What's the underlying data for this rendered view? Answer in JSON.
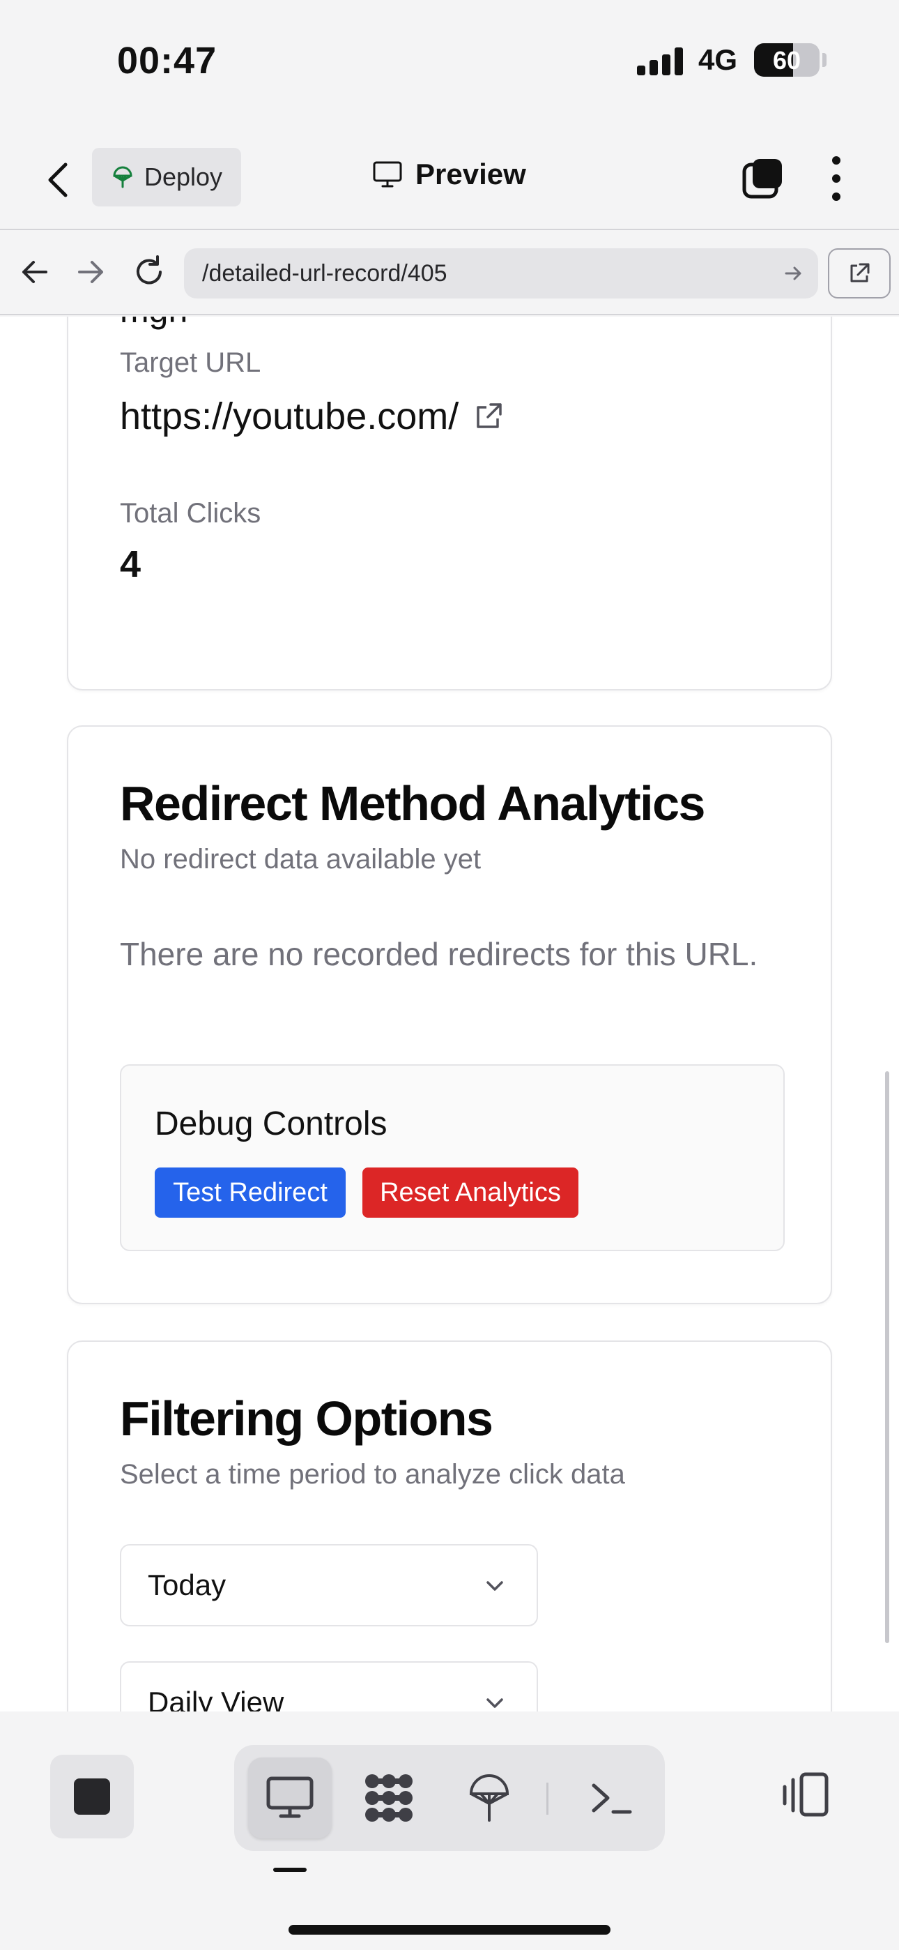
{
  "status_bar": {
    "time": "00:47",
    "network": "4G",
    "battery": "60",
    "battery_level": 0.6
  },
  "header": {
    "deploy_label": "Deploy",
    "preview_label": "Preview"
  },
  "browser": {
    "url": "/detailed-url-record/405"
  },
  "url_details": {
    "partial_value": "mgh",
    "target_url_label": "Target URL",
    "target_url": "https://youtube.com/",
    "total_clicks_label": "Total Clicks",
    "total_clicks": "4"
  },
  "redirect_analytics": {
    "title": "Redirect Method Analytics",
    "subtitle": "No redirect data available yet",
    "empty_message": "There are no recorded redirects for this URL.",
    "debug_title": "Debug Controls",
    "test_redirect_label": "Test Redirect",
    "reset_analytics_label": "Reset Analytics"
  },
  "filtering": {
    "title": "Filtering Options",
    "subtitle": "Select a time period to analyze click data",
    "period_select": "Today",
    "view_select": "Daily View"
  },
  "bottom_toolbar": {
    "icons": [
      "stop-icon",
      "desktop-icon",
      "apps-icon",
      "deploy-icon",
      "terminal-icon",
      "side-panel-icon"
    ]
  },
  "colors": {
    "blue": "#2563eb",
    "red": "#dc2626",
    "muted": "#71717a"
  }
}
